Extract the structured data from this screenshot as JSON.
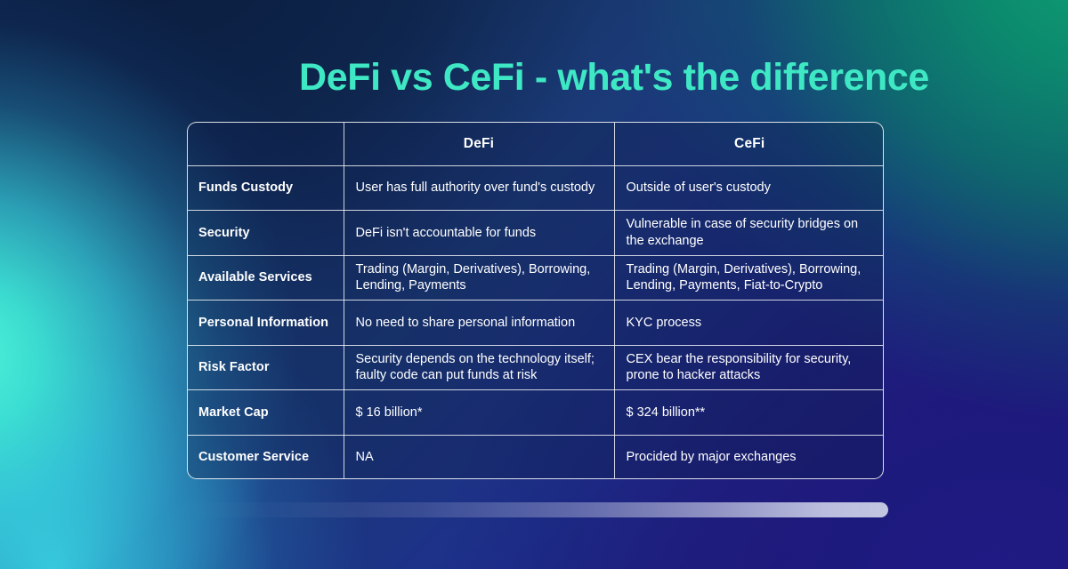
{
  "slide": {
    "title": "DeFi vs CeFi - what's the difference",
    "title_color": "#3fe8c4",
    "background_colors": {
      "navy": "#0c2145",
      "mint": "#3ee8d8",
      "cyan": "#3ce0e8",
      "sea_green": "#0c8a6e",
      "indigo": "#1d1a7e"
    }
  },
  "table": {
    "headers": [
      "",
      "DeFi",
      "CeFi"
    ],
    "rows": [
      {
        "label": "Funds Custody",
        "defi": "User has full authority over fund's custody",
        "cefi": "Outside of user's custody"
      },
      {
        "label": "Security",
        "defi": "DeFi isn't accountable for funds",
        "cefi": "Vulnerable in case of security bridges on the exchange"
      },
      {
        "label": "Available Services",
        "defi": "Trading (Margin, Derivatives), Borrowing, Lending, Payments",
        "cefi": "Trading (Margin, Derivatives), Borrowing, Lending, Payments, Fiat-to-Crypto"
      },
      {
        "label": "Personal Information",
        "defi": "No need to share personal information",
        "cefi": "KYC process"
      },
      {
        "label": "Risk Factor",
        "defi": "Security depends on the technology itself; faulty code can put funds at risk",
        "cefi": "CEX bear the responsibility for security, prone to hacker attacks"
      },
      {
        "label": "Market Cap",
        "defi": "$ 16 billion*",
        "cefi": "$ 324 billion**"
      },
      {
        "label": "Customer Service",
        "defi": "NA",
        "cefi": "Procided by major exchanges"
      }
    ]
  },
  "progress_bar": {
    "accent_color": "#c3c6e0"
  }
}
